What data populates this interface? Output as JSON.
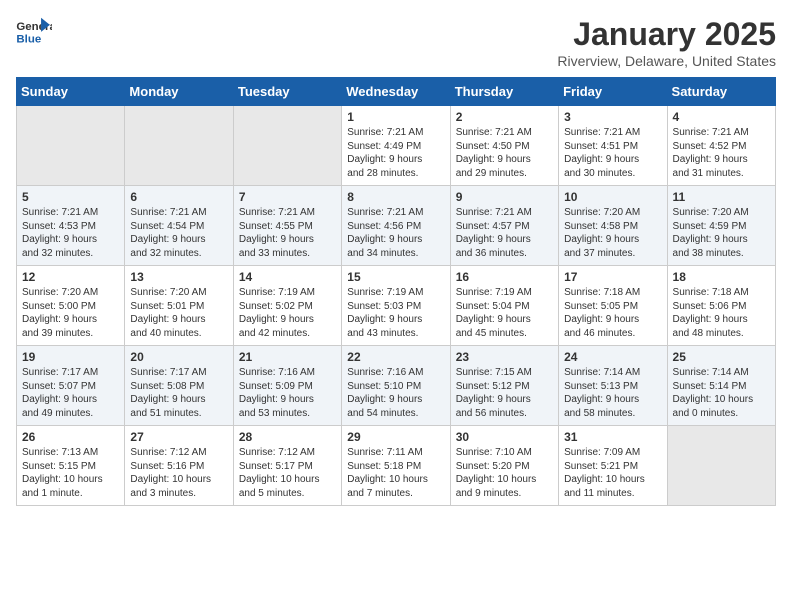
{
  "header": {
    "logo_line1": "General",
    "logo_line2": "Blue",
    "month": "January 2025",
    "location": "Riverview, Delaware, United States"
  },
  "days_of_week": [
    "Sunday",
    "Monday",
    "Tuesday",
    "Wednesday",
    "Thursday",
    "Friday",
    "Saturday"
  ],
  "weeks": [
    [
      {
        "day": "",
        "info": ""
      },
      {
        "day": "",
        "info": ""
      },
      {
        "day": "",
        "info": ""
      },
      {
        "day": "1",
        "info": "Sunrise: 7:21 AM\nSunset: 4:49 PM\nDaylight: 9 hours\nand 28 minutes."
      },
      {
        "day": "2",
        "info": "Sunrise: 7:21 AM\nSunset: 4:50 PM\nDaylight: 9 hours\nand 29 minutes."
      },
      {
        "day": "3",
        "info": "Sunrise: 7:21 AM\nSunset: 4:51 PM\nDaylight: 9 hours\nand 30 minutes."
      },
      {
        "day": "4",
        "info": "Sunrise: 7:21 AM\nSunset: 4:52 PM\nDaylight: 9 hours\nand 31 minutes."
      }
    ],
    [
      {
        "day": "5",
        "info": "Sunrise: 7:21 AM\nSunset: 4:53 PM\nDaylight: 9 hours\nand 32 minutes."
      },
      {
        "day": "6",
        "info": "Sunrise: 7:21 AM\nSunset: 4:54 PM\nDaylight: 9 hours\nand 32 minutes."
      },
      {
        "day": "7",
        "info": "Sunrise: 7:21 AM\nSunset: 4:55 PM\nDaylight: 9 hours\nand 33 minutes."
      },
      {
        "day": "8",
        "info": "Sunrise: 7:21 AM\nSunset: 4:56 PM\nDaylight: 9 hours\nand 34 minutes."
      },
      {
        "day": "9",
        "info": "Sunrise: 7:21 AM\nSunset: 4:57 PM\nDaylight: 9 hours\nand 36 minutes."
      },
      {
        "day": "10",
        "info": "Sunrise: 7:20 AM\nSunset: 4:58 PM\nDaylight: 9 hours\nand 37 minutes."
      },
      {
        "day": "11",
        "info": "Sunrise: 7:20 AM\nSunset: 4:59 PM\nDaylight: 9 hours\nand 38 minutes."
      }
    ],
    [
      {
        "day": "12",
        "info": "Sunrise: 7:20 AM\nSunset: 5:00 PM\nDaylight: 9 hours\nand 39 minutes."
      },
      {
        "day": "13",
        "info": "Sunrise: 7:20 AM\nSunset: 5:01 PM\nDaylight: 9 hours\nand 40 minutes."
      },
      {
        "day": "14",
        "info": "Sunrise: 7:19 AM\nSunset: 5:02 PM\nDaylight: 9 hours\nand 42 minutes."
      },
      {
        "day": "15",
        "info": "Sunrise: 7:19 AM\nSunset: 5:03 PM\nDaylight: 9 hours\nand 43 minutes."
      },
      {
        "day": "16",
        "info": "Sunrise: 7:19 AM\nSunset: 5:04 PM\nDaylight: 9 hours\nand 45 minutes."
      },
      {
        "day": "17",
        "info": "Sunrise: 7:18 AM\nSunset: 5:05 PM\nDaylight: 9 hours\nand 46 minutes."
      },
      {
        "day": "18",
        "info": "Sunrise: 7:18 AM\nSunset: 5:06 PM\nDaylight: 9 hours\nand 48 minutes."
      }
    ],
    [
      {
        "day": "19",
        "info": "Sunrise: 7:17 AM\nSunset: 5:07 PM\nDaylight: 9 hours\nand 49 minutes."
      },
      {
        "day": "20",
        "info": "Sunrise: 7:17 AM\nSunset: 5:08 PM\nDaylight: 9 hours\nand 51 minutes."
      },
      {
        "day": "21",
        "info": "Sunrise: 7:16 AM\nSunset: 5:09 PM\nDaylight: 9 hours\nand 53 minutes."
      },
      {
        "day": "22",
        "info": "Sunrise: 7:16 AM\nSunset: 5:10 PM\nDaylight: 9 hours\nand 54 minutes."
      },
      {
        "day": "23",
        "info": "Sunrise: 7:15 AM\nSunset: 5:12 PM\nDaylight: 9 hours\nand 56 minutes."
      },
      {
        "day": "24",
        "info": "Sunrise: 7:14 AM\nSunset: 5:13 PM\nDaylight: 9 hours\nand 58 minutes."
      },
      {
        "day": "25",
        "info": "Sunrise: 7:14 AM\nSunset: 5:14 PM\nDaylight: 10 hours\nand 0 minutes."
      }
    ],
    [
      {
        "day": "26",
        "info": "Sunrise: 7:13 AM\nSunset: 5:15 PM\nDaylight: 10 hours\nand 1 minute."
      },
      {
        "day": "27",
        "info": "Sunrise: 7:12 AM\nSunset: 5:16 PM\nDaylight: 10 hours\nand 3 minutes."
      },
      {
        "day": "28",
        "info": "Sunrise: 7:12 AM\nSunset: 5:17 PM\nDaylight: 10 hours\nand 5 minutes."
      },
      {
        "day": "29",
        "info": "Sunrise: 7:11 AM\nSunset: 5:18 PM\nDaylight: 10 hours\nand 7 minutes."
      },
      {
        "day": "30",
        "info": "Sunrise: 7:10 AM\nSunset: 5:20 PM\nDaylight: 10 hours\nand 9 minutes."
      },
      {
        "day": "31",
        "info": "Sunrise: 7:09 AM\nSunset: 5:21 PM\nDaylight: 10 hours\nand 11 minutes."
      },
      {
        "day": "",
        "info": ""
      }
    ]
  ]
}
